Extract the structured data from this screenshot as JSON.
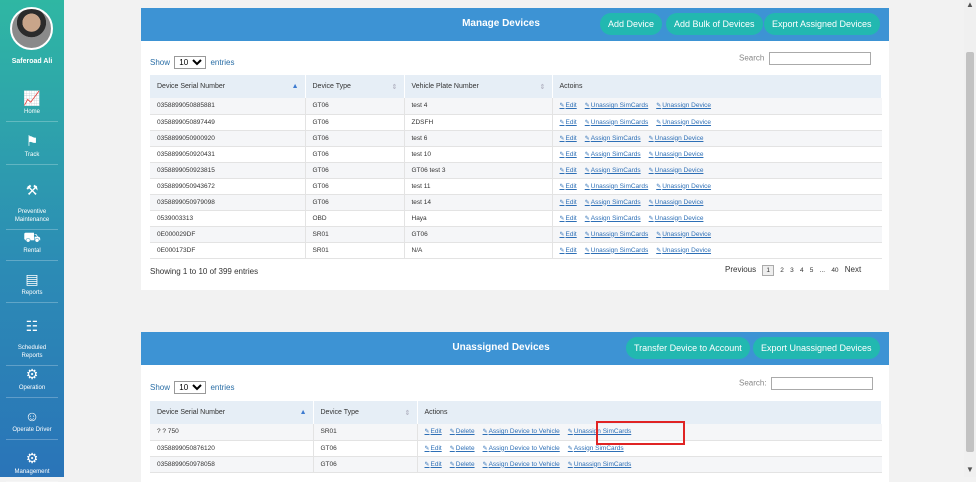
{
  "user": {
    "name": "Saferoad Ali"
  },
  "sidebar": {
    "items": [
      {
        "label": "Home",
        "icon": "chart-icon"
      },
      {
        "label": "Track",
        "icon": "route-icon"
      },
      {
        "label": "Preventive\nMaintenance",
        "icon": "tools-icon"
      },
      {
        "label": "Rental",
        "icon": "car-icon"
      },
      {
        "label": "Reports",
        "icon": "presentation-icon"
      },
      {
        "label": "Scheduled\nReports",
        "icon": "clipboard-icon"
      },
      {
        "label": "Operation",
        "icon": "gears-icon"
      },
      {
        "label": "Operate Driver",
        "icon": "driver-icon"
      },
      {
        "label": "Management",
        "icon": "gears-icon"
      }
    ]
  },
  "manage": {
    "title": "Manage Devices",
    "buttons": [
      "Add Device",
      "Add Bulk of Devices",
      "Export Assigned Devices"
    ],
    "show_label": "Show",
    "entries_value": "10",
    "entries_label": "entries",
    "search_label": "Search",
    "columns": [
      "Device Serial Number",
      "Device Type",
      "Vehicle Plate Number",
      "Actoins"
    ],
    "rows": [
      {
        "serial": "0358899050885881",
        "type": "GT06",
        "plate": "test 4",
        "actions": [
          "Edit",
          "Unassign SimCards",
          "Unassign Device"
        ]
      },
      {
        "serial": "0358899050897449",
        "type": "GT06",
        "plate": "ZDSFH",
        "actions": [
          "Edit",
          "Unassign SimCards",
          "Unassign Device"
        ]
      },
      {
        "serial": "0358899050900920",
        "type": "GT06",
        "plate": "test 6",
        "actions": [
          "Edit",
          "Assign SimCards",
          "Unassign Device"
        ]
      },
      {
        "serial": "0358899050920431",
        "type": "GT06",
        "plate": "test 10",
        "actions": [
          "Edit",
          "Assign SimCards",
          "Unassign Device"
        ]
      },
      {
        "serial": "0358899050923815",
        "type": "GT06",
        "plate": "GT06 test 3",
        "actions": [
          "Edit",
          "Assign SimCards",
          "Unassign Device"
        ]
      },
      {
        "serial": "0358899050943672",
        "type": "GT06",
        "plate": "test 11",
        "actions": [
          "Edit",
          "Unassign SimCards",
          "Unassign Device"
        ]
      },
      {
        "serial": "0358899050979098",
        "type": "GT06",
        "plate": "test 14",
        "actions": [
          "Edit",
          "Assign SimCards",
          "Unassign Device"
        ]
      },
      {
        "serial": "0539003313",
        "type": "OBD",
        "plate": "Haya",
        "actions": [
          "Edit",
          "Assign SimCards",
          "Unassign Device"
        ]
      },
      {
        "serial": "0E000029DF",
        "type": "SR01",
        "plate": "GT06",
        "actions": [
          "Edit",
          "Unassign SimCards",
          "Unassign Device"
        ]
      },
      {
        "serial": "0E000173DF",
        "type": "SR01",
        "plate": "N/A",
        "actions": [
          "Edit",
          "Unassign SimCards",
          "Unassign Device"
        ]
      }
    ],
    "info": "Showing 1 to 10 of 399 entries",
    "pagination": {
      "previous": "Previous",
      "pages": [
        "1",
        "2",
        "3",
        "4",
        "5",
        "...",
        "40"
      ],
      "next": "Next"
    }
  },
  "unassigned": {
    "title": "Unassigned Devices",
    "buttons": [
      "Transfer Device to Account",
      "Export Unassigned Devices"
    ],
    "show_label": "Show",
    "entries_value": "10",
    "entries_label": "entries",
    "search_label": "Search:",
    "columns": [
      "Device Serial Number",
      "Device Type",
      "Actions"
    ],
    "rows": [
      {
        "serial": "? ? 750",
        "type": "SR01",
        "actions": [
          "Edit",
          "Delete",
          "Assign Device to Vehicle",
          "Unassign SimCards"
        ]
      },
      {
        "serial": "0358899050876120",
        "type": "GT06",
        "actions": [
          "Edit",
          "Delete",
          "Assign Device to Vehicle",
          "Assign SimCards"
        ]
      },
      {
        "serial": "0358899050978058",
        "type": "GT06",
        "actions": [
          "Edit",
          "Delete",
          "Assign Device to Vehicle",
          "Unassign SimCards"
        ]
      }
    ]
  },
  "colors": {
    "header": "#3d93d4",
    "button": "#22b8b0",
    "link": "#2d6fb6",
    "highlight": "#e02424"
  }
}
